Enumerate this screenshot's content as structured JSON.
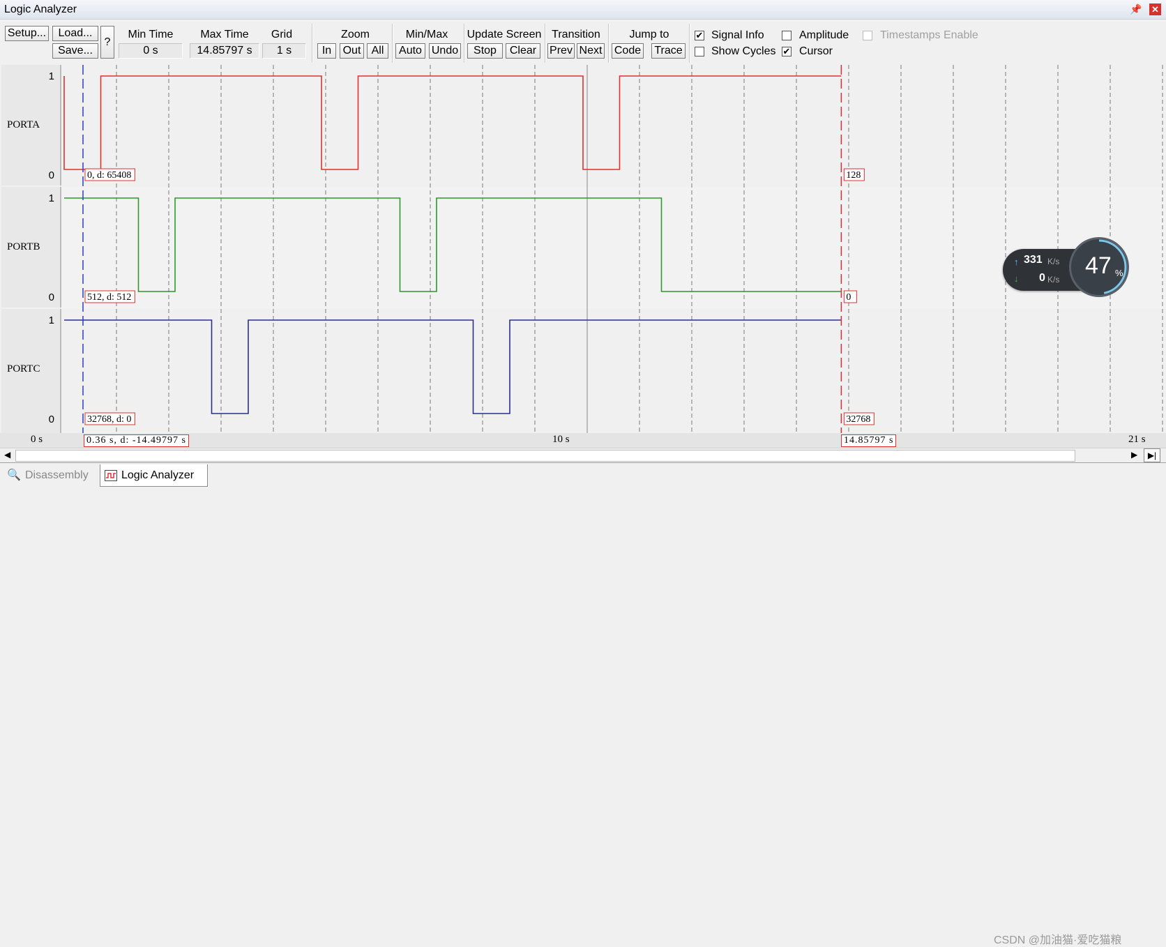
{
  "window": {
    "title": "Logic Analyzer"
  },
  "toolbar": {
    "setup": "Setup...",
    "load": "Load...",
    "save": "Save...",
    "help": "?",
    "min_time_label": "Min Time",
    "min_time_value": "0 s",
    "max_time_label": "Max Time",
    "max_time_value": "14.85797 s",
    "grid_label": "Grid",
    "grid_value": "1 s",
    "zoom_label": "Zoom",
    "zoom_in": "In",
    "zoom_out": "Out",
    "zoom_all": "All",
    "minmax_label": "Min/Max",
    "minmax_auto": "Auto",
    "minmax_undo": "Undo",
    "update_label": "Update Screen",
    "update_stop": "Stop",
    "update_clear": "Clear",
    "transition_label": "Transition",
    "transition_prev": "Prev",
    "transition_next": "Next",
    "jump_label": "Jump to",
    "jump_code": "Code",
    "jump_trace": "Trace",
    "signal_info": {
      "label": "Signal Info",
      "checked": true
    },
    "amplitude": {
      "label": "Amplitude",
      "checked": false
    },
    "timestamps": {
      "label": "Timestamps Enable",
      "checked": false,
      "enabled": false
    },
    "show_cycles": {
      "label": "Show Cycles",
      "checked": false
    },
    "cursor": {
      "label": "Cursor",
      "checked": true
    }
  },
  "signals": [
    {
      "name": "PORTA",
      "high": "1",
      "low": "0",
      "color": "#e03131",
      "info_left": "0,   d: 65408",
      "info_right": "128",
      "transitions": [
        [
          0.0,
          0
        ],
        [
          0.7,
          1
        ],
        [
          4.92,
          0
        ],
        [
          5.62,
          1
        ],
        [
          9.92,
          0
        ],
        [
          10.62,
          1
        ]
      ]
    },
    {
      "name": "PORTB",
      "high": "1",
      "low": "0",
      "color": "#2b9a2b",
      "info_left": "512,  d: 512",
      "info_right": "0",
      "transitions": [
        [
          0.0,
          1
        ],
        [
          1.42,
          0
        ],
        [
          2.12,
          1
        ],
        [
          6.42,
          0
        ],
        [
          7.12,
          1
        ],
        [
          11.42,
          0
        ]
      ]
    },
    {
      "name": "PORTC",
      "high": "1",
      "low": "0",
      "color": "#2a2f8f",
      "info_left": "32768,  d: 0",
      "info_right": "32768",
      "transitions": [
        [
          0.0,
          1
        ],
        [
          2.82,
          0
        ],
        [
          3.52,
          1
        ],
        [
          7.82,
          0
        ],
        [
          8.52,
          1
        ]
      ]
    }
  ],
  "time_axis": {
    "start_label": "0 s",
    "mid_label": "10 s",
    "end_label": "21 s",
    "t_min": 0,
    "t_max": 21,
    "t_end": 14.85797,
    "blue_cursor_time": 0.36,
    "cursor_info": "0.36  s,   d: -14.49797  s",
    "end_info": "14.85797  s"
  },
  "network_widget": {
    "upload": "331",
    "upload_unit": "K/s",
    "download": "0",
    "download_unit": "K/s",
    "percent": "47",
    "percent_unit": "%"
  },
  "tabs": [
    {
      "label": "Disassembly",
      "active": false
    },
    {
      "label": "Logic Analyzer",
      "active": true
    }
  ],
  "watermark": "CSDN @加油猫·爱吃猫粮",
  "colors": {
    "blue_cursor": "#1f3fd6",
    "red_cursor": "#e03131",
    "grid": "#7a7a7a"
  }
}
